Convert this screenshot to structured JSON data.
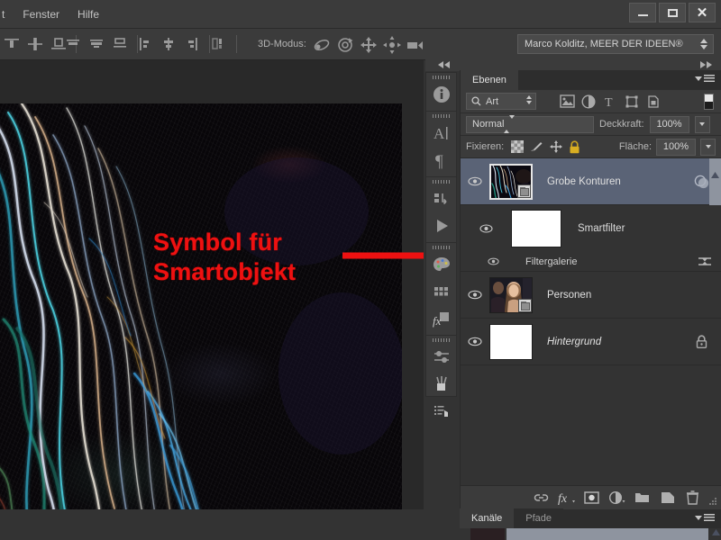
{
  "window": {
    "controls": [
      {
        "name": "minimize",
        "label": "–"
      },
      {
        "name": "maximize",
        "label": "☐"
      },
      {
        "name": "close",
        "label": "✕"
      }
    ]
  },
  "menubar": {
    "items": [
      {
        "label": "t"
      },
      {
        "label": "Fenster"
      },
      {
        "label": "Hilfe"
      }
    ]
  },
  "options_bar": {
    "mode3d_label": "3D-Modus:",
    "mode3d_icons": [
      "orbit-3d-icon",
      "roll-3d-icon",
      "pan-3d-icon",
      "slide-3d-icon",
      "camera-3d-icon"
    ],
    "align_icons": [
      "align-vertical-top-icon",
      "align-vertical-center-icon",
      "align-vertical-bottom-icon",
      "align-horizontal-left-icon",
      "align-horizontal-center-icon",
      "align-horizontal-right-icon",
      "distribute-left-icon",
      "distribute-center-icon",
      "distribute-right-icon",
      "auto-align-icon"
    ],
    "preset_select": {
      "value": "Marco Kolditz, MEER DER IDEEN®"
    }
  },
  "annotation": {
    "text": "Symbol für\nSmartobjekt",
    "color": "#ee1111",
    "arrow": "red-arrow-pointing-right"
  },
  "panel": {
    "tabs": [
      {
        "label": "Ebenen",
        "active": true
      }
    ],
    "filter": {
      "kind_label": "Art",
      "search_icon": "magnifier-icon",
      "type_icons": [
        "pixel-layer-filter-icon",
        "adjustment-layer-filter-icon",
        "type-layer-filter-icon",
        "shape-layer-filter-icon",
        "smart-object-filter-icon"
      ],
      "toggle": "filter-enable-toggle"
    },
    "blend": {
      "mode": "Normal",
      "opacity_label": "Deckkraft:",
      "opacity_value": "100%"
    },
    "lock": {
      "label": "Fixieren:",
      "icons": [
        "lock-transparency-icon",
        "lock-image-icon",
        "lock-position-icon",
        "lock-all-icon"
      ],
      "fill_label": "Fläche:",
      "fill_value": "100%"
    },
    "layers": [
      {
        "name": "Grobe Konturen",
        "visible": true,
        "selected": true,
        "italic": false,
        "smart_object": true,
        "right_icon": "layer-effects-icon",
        "thumb_type": "neon-hair-thumb"
      },
      {
        "name": "Smartfilter",
        "visible": true,
        "selected": false,
        "is_sub": true,
        "thumb_type": "white-mask-thumb"
      },
      {
        "name": "Filtergalerie",
        "visible": true,
        "selected": false,
        "is_filter": true,
        "right_icon": "filter-blending-options-icon"
      },
      {
        "name": "Personen",
        "visible": true,
        "selected": false,
        "italic": false,
        "smart_object": true,
        "thumb_type": "people-photo-thumb"
      },
      {
        "name": "Hintergrund",
        "visible": true,
        "selected": false,
        "italic": true,
        "smart_object": false,
        "right_icon": "lock-icon",
        "thumb_type": "white-thumb"
      }
    ],
    "bottom_buttons": [
      "link-layers-icon",
      "add-layer-style-icon",
      "add-layer-mask-icon",
      "new-adjustment-layer-icon",
      "new-group-icon",
      "new-layer-icon",
      "delete-layer-icon"
    ]
  },
  "bottom_dock": {
    "tabs": [
      {
        "label": "Kanäle",
        "active": true
      },
      {
        "label": "Pfade",
        "active": false
      }
    ]
  },
  "toolstrip": {
    "groups": [
      {
        "buttons": [
          "info-icon"
        ]
      },
      {
        "buttons": [
          "character-icon",
          "paragraph-icon"
        ]
      },
      {
        "buttons": [
          "layer-comps-icon",
          "timeline-play-icon"
        ]
      },
      {
        "buttons": [
          "color-palette-icon",
          "swatches-icon",
          "styles-fx-icon"
        ]
      },
      {
        "buttons": [
          "adjustments-icon",
          "brush-presets-icon",
          "actions-icon"
        ]
      }
    ]
  },
  "colors": {
    "panel_bg": "#333333",
    "chrome_bg": "#3b3b3b",
    "selection": "#5a6376",
    "accent_red": "#ee1111",
    "text": "#e0e0e0"
  }
}
